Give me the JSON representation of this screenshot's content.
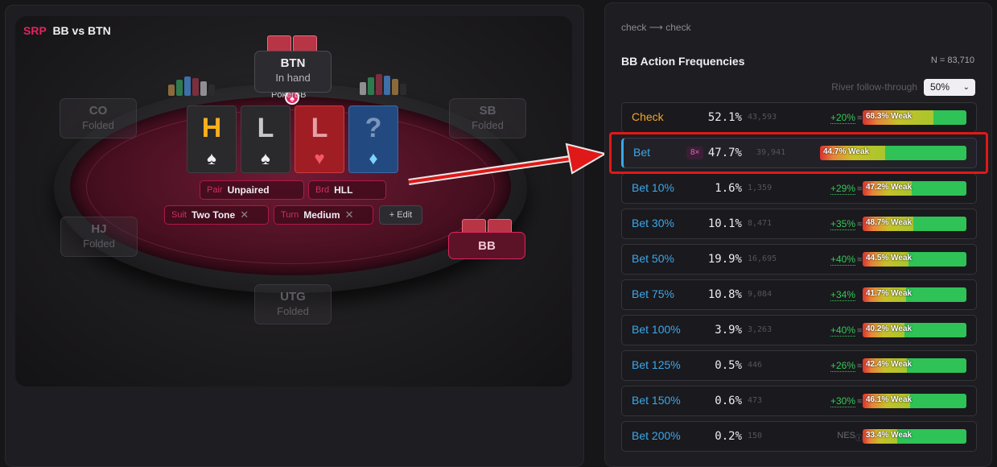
{
  "spot": {
    "tag": "SRP",
    "positions": "BB vs BTN"
  },
  "seats": {
    "btn": {
      "name": "BTN",
      "status": "In hand"
    },
    "co": {
      "name": "CO",
      "status": "Folded"
    },
    "sb": {
      "name": "SB",
      "status": "Folded"
    },
    "hj": {
      "name": "HJ",
      "status": "Folded"
    },
    "utg": {
      "name": "UTG",
      "status": "Folded"
    },
    "bb": {
      "name": "BB"
    }
  },
  "table_brand": "PokerBB",
  "board": [
    {
      "rank": "H",
      "suit": "♠",
      "style": "dark",
      "rank_color": "#f5b01e",
      "suit_color": "#f0eef2"
    },
    {
      "rank": "L",
      "suit": "♠",
      "style": "dark",
      "rank_color": "#c9c7cc",
      "suit_color": "#f0eef2"
    },
    {
      "rank": "L",
      "suit": "♥",
      "style": "red",
      "rank_color": "#e6a0a4",
      "suit_color": "#f25a63"
    },
    {
      "rank": "?",
      "suit": "♦",
      "style": "blue",
      "rank_color": "#7a96bb",
      "suit_color": "#7fd3ff"
    }
  ],
  "tags": {
    "pair": {
      "key": "Pair",
      "value": "Unpaired"
    },
    "brd": {
      "key": "Brd",
      "value": "HLL"
    },
    "suit": {
      "key": "Suit",
      "value": "Two Tone"
    },
    "turn": {
      "key": "Turn",
      "value": "Medium"
    },
    "edit": "+ Edit"
  },
  "panel": {
    "breadcrumb": "check ⟶ check",
    "title": "BB Action Frequencies",
    "n_count": "N = 83,710",
    "follow_label": "River follow-through",
    "follow_value": "50%"
  },
  "actions": [
    {
      "label": "Check",
      "pct": "52.1%",
      "count": "43,593",
      "delta": "+20%",
      "bar_label": "68.3% Weak",
      "bar_value": 0.683
    },
    {
      "label": "Bet",
      "badge": "8×",
      "pct": "47.7%",
      "count": "39,941",
      "delta": "",
      "bar_label": "44.7% Weak",
      "bar_value": 0.447
    },
    {
      "label": "Bet 10%",
      "pct": "1.6%",
      "count": "1,359",
      "delta": "+29%",
      "bar_label": "47.2% Weak",
      "bar_value": 0.472
    },
    {
      "label": "Bet 30%",
      "pct": "10.1%",
      "count": "8,471",
      "delta": "+35%",
      "bar_label": "48.7% Weak",
      "bar_value": 0.487
    },
    {
      "label": "Bet 50%",
      "pct": "19.9%",
      "count": "16,695",
      "delta": "+40%",
      "bar_label": "44.5% Weak",
      "bar_value": 0.445
    },
    {
      "label": "Bet 75%",
      "pct": "10.8%",
      "count": "9,084",
      "delta": "+34%",
      "bar_label": "41.7% Weak",
      "bar_value": 0.417
    },
    {
      "label": "Bet 100%",
      "pct": "3.9%",
      "count": "3,263",
      "delta": "+40%",
      "bar_label": "40.2% Weak",
      "bar_value": 0.402
    },
    {
      "label": "Bet 125%",
      "pct": "0.5%",
      "count": "446",
      "delta": "+26%",
      "bar_label": "42.4% Weak",
      "bar_value": 0.424
    },
    {
      "label": "Bet 150%",
      "pct": "0.6%",
      "count": "473",
      "delta": "+30%",
      "bar_label": "46.1% Weak",
      "bar_value": 0.461
    },
    {
      "label": "Bet 200%",
      "pct": "0.2%",
      "count": "150",
      "nes": "NES",
      "bar_label": "33.4% Weak",
      "bar_value": 0.334
    }
  ],
  "colors": {
    "accent_pink": "#e0245e",
    "accent_blue": "#3ba7ea",
    "check_orange": "#f5a623",
    "positive_green": "#34c759",
    "highlight_red": "#e01818"
  }
}
